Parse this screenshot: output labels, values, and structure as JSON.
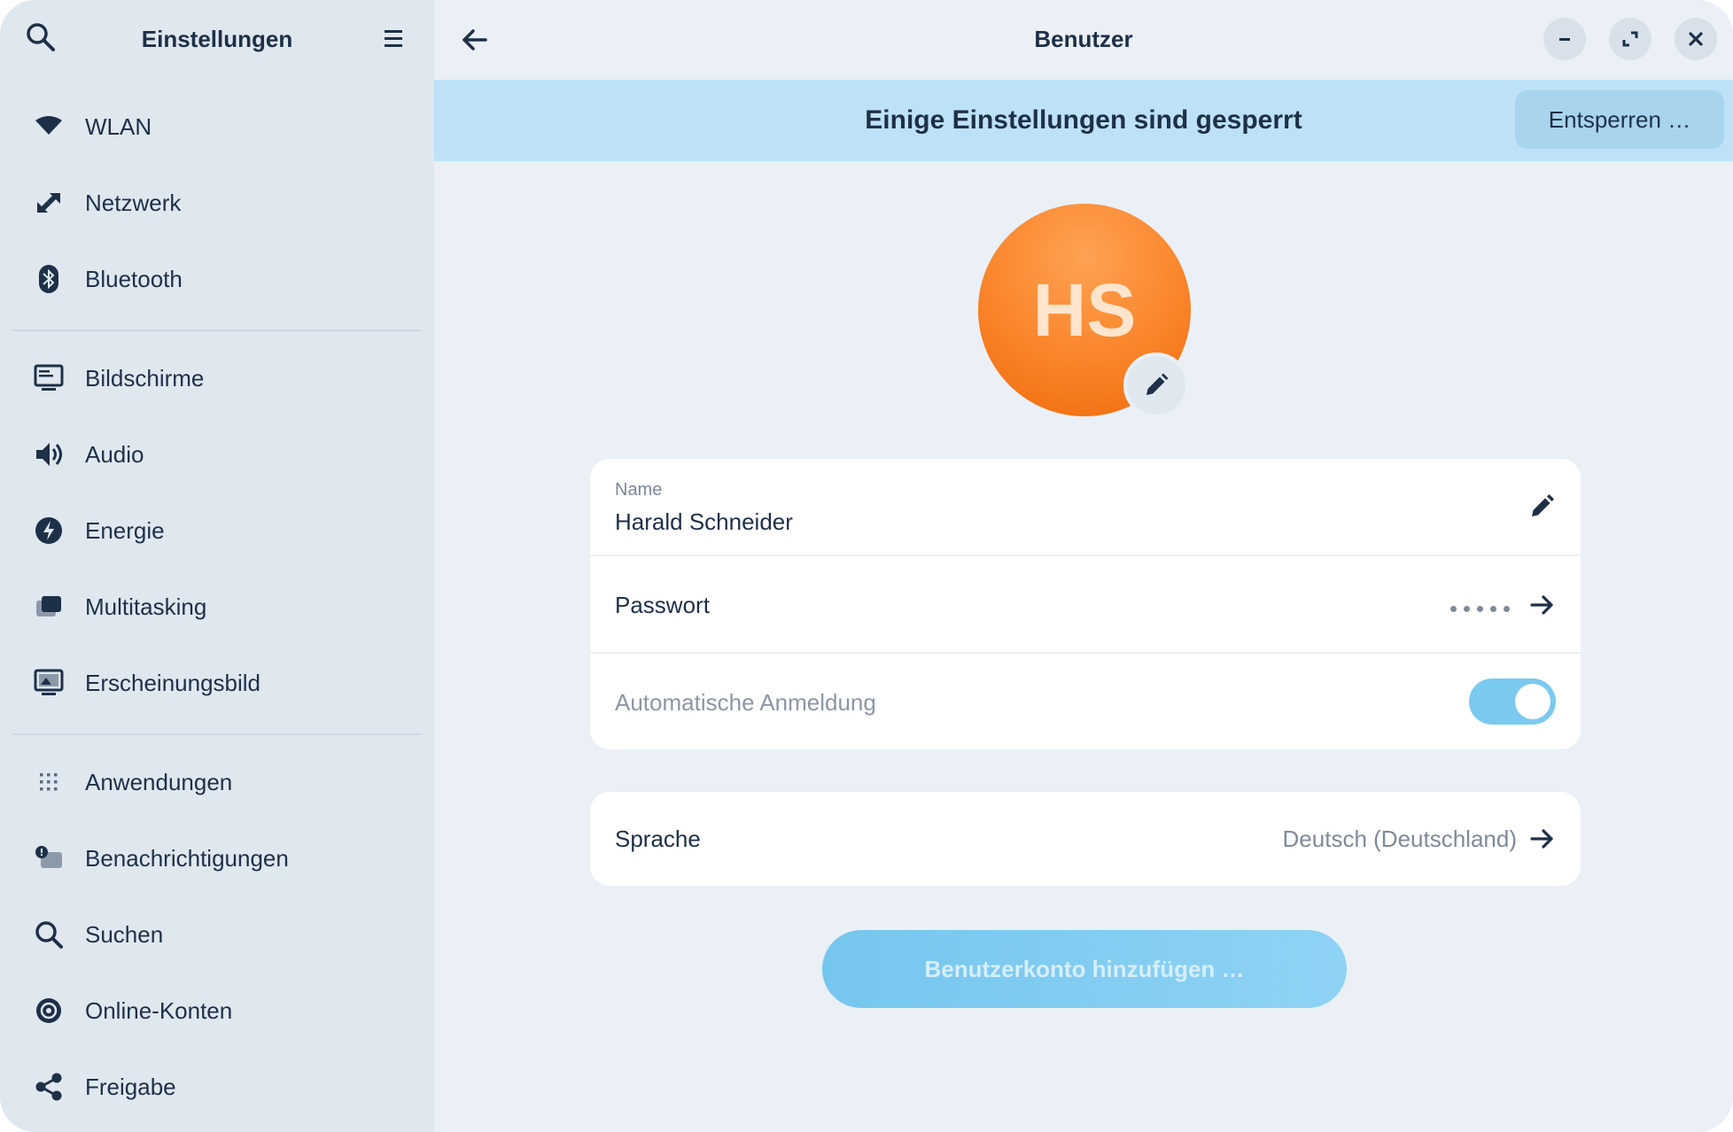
{
  "sidebar": {
    "title": "Einstellungen",
    "items": [
      {
        "label": "WLAN",
        "icon": "wifi-icon"
      },
      {
        "label": "Netzwerk",
        "icon": "network-icon"
      },
      {
        "label": "Bluetooth",
        "icon": "bluetooth-icon"
      },
      {
        "label": "Bildschirme",
        "icon": "display-icon"
      },
      {
        "label": "Audio",
        "icon": "speaker-icon"
      },
      {
        "label": "Energie",
        "icon": "power-icon"
      },
      {
        "label": "Multitasking",
        "icon": "multitasking-icon"
      },
      {
        "label": "Erscheinungsbild",
        "icon": "appearance-icon"
      },
      {
        "label": "Anwendungen",
        "icon": "apps-grid-icon"
      },
      {
        "label": "Benachrichtigungen",
        "icon": "notifications-icon"
      },
      {
        "label": "Suchen",
        "icon": "search-icon"
      },
      {
        "label": "Online-Konten",
        "icon": "at-sign-icon"
      },
      {
        "label": "Freigabe",
        "icon": "share-icon"
      }
    ]
  },
  "header": {
    "title": "Benutzer"
  },
  "banner": {
    "text": "Einige Einstellungen sind gesperrt",
    "unlock_label": "Entsperren …"
  },
  "user": {
    "initials": "HS",
    "avatar_color": "#f9842a",
    "name_caption": "Name",
    "name": "Harald Schneider",
    "password_label": "Passwort",
    "password_dots": 5,
    "autologin_label": "Automatische Anmeldung",
    "autologin_enabled": true,
    "language_label": "Sprache",
    "language_value": "Deutsch (Deutschland)"
  },
  "actions": {
    "add_account_label": "Benutzerkonto hinzufügen …"
  },
  "colors": {
    "accent": "#7acaf0",
    "banner": "#bde2f8",
    "sidebar": "#dfe7ef"
  }
}
